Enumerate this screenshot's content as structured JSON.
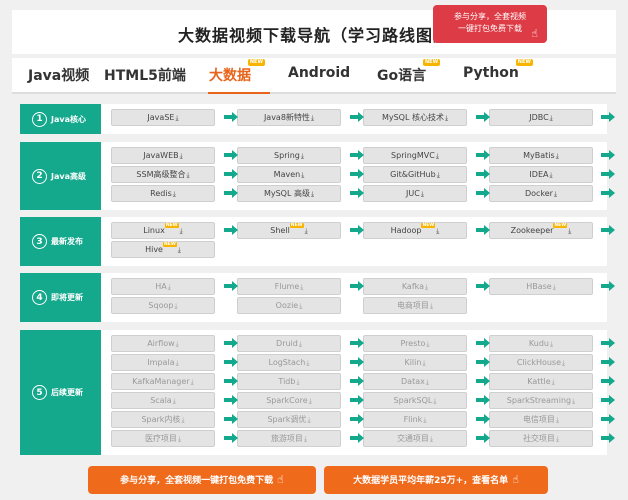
{
  "header": {
    "title": "大数据视频下载导航（学习路线图）",
    "share_line1": "参与分享，全套视频",
    "share_line2": "一键打包免费下载"
  },
  "tabs": [
    {
      "label": "Java视频",
      "active": false,
      "new": false
    },
    {
      "label": "HTML5前端",
      "active": false,
      "new": false
    },
    {
      "label": "大数据",
      "active": true,
      "new": true
    },
    {
      "label": "Android",
      "active": false,
      "new": false
    },
    {
      "label": "Go语言",
      "active": false,
      "new": true
    },
    {
      "label": "Python",
      "active": false,
      "new": true
    }
  ],
  "new_label": "NEW",
  "download_icon": "⤓",
  "sections": [
    {
      "num": "1",
      "name": "Java核心",
      "dim": false,
      "rows": [
        [
          {
            "t": "JavaSE"
          },
          {
            "t": "Java8新特性"
          },
          {
            "t": "MySQL 核心技术"
          },
          {
            "t": "JDBC"
          }
        ]
      ]
    },
    {
      "num": "2",
      "name": "Java高级",
      "dim": false,
      "rows": [
        [
          {
            "t": "JavaWEB"
          },
          {
            "t": "Spring"
          },
          {
            "t": "SpringMVC"
          },
          {
            "t": "MyBatis"
          }
        ],
        [
          {
            "t": "SSM高级整合"
          },
          {
            "t": "Maven"
          },
          {
            "t": "Git&GitHub"
          },
          {
            "t": "IDEA"
          }
        ],
        [
          {
            "t": "Redis"
          },
          {
            "t": "MySQL 高级"
          },
          {
            "t": "JUC"
          },
          {
            "t": "Docker"
          }
        ]
      ]
    },
    {
      "num": "3",
      "name": "最新发布",
      "dim": false,
      "rows": [
        [
          {
            "t": "Linux",
            "n": true
          },
          {
            "t": "Shell",
            "n": true
          },
          {
            "t": "Hadoop",
            "n": true
          },
          {
            "t": "Zookeeper",
            "n": true
          }
        ],
        [
          {
            "t": "Hive",
            "n": true
          }
        ]
      ]
    },
    {
      "num": "4",
      "name": "即将更新",
      "dim": true,
      "rows": [
        [
          {
            "t": "HA"
          },
          {
            "t": "Flume"
          },
          {
            "t": "Kafka"
          },
          {
            "t": "HBase"
          }
        ],
        [
          {
            "t": "Sqoop"
          },
          {
            "t": "Oozie"
          },
          {
            "t": "电商项目"
          }
        ]
      ]
    },
    {
      "num": "5",
      "name": "后续更新",
      "dim": true,
      "rows": [
        [
          {
            "t": "Airflow"
          },
          {
            "t": "Druid"
          },
          {
            "t": "Presto"
          },
          {
            "t": "Kudu"
          }
        ],
        [
          {
            "t": "Impala"
          },
          {
            "t": "LogStach"
          },
          {
            "t": "Kilin"
          },
          {
            "t": "ClickHouse"
          }
        ],
        [
          {
            "t": "KafkaManager"
          },
          {
            "t": "Tidb"
          },
          {
            "t": "Datax"
          },
          {
            "t": "Kattle"
          }
        ],
        [
          {
            "t": "Scala"
          },
          {
            "t": "SparkCore"
          },
          {
            "t": "SparkSQL"
          },
          {
            "t": "SparkStreaming"
          }
        ],
        [
          {
            "t": "Spark内核"
          },
          {
            "t": "Spark调优"
          },
          {
            "t": "Flink"
          },
          {
            "t": "电信项目"
          }
        ],
        [
          {
            "t": "医疗项目"
          },
          {
            "t": "旅游项目"
          },
          {
            "t": "交通项目"
          },
          {
            "t": "社交项目"
          }
        ]
      ]
    }
  ],
  "cta": {
    "left": "参与分享，全套视频一键打包免费下载",
    "right": "大数据学员平均年薪25万+，查看名单"
  }
}
